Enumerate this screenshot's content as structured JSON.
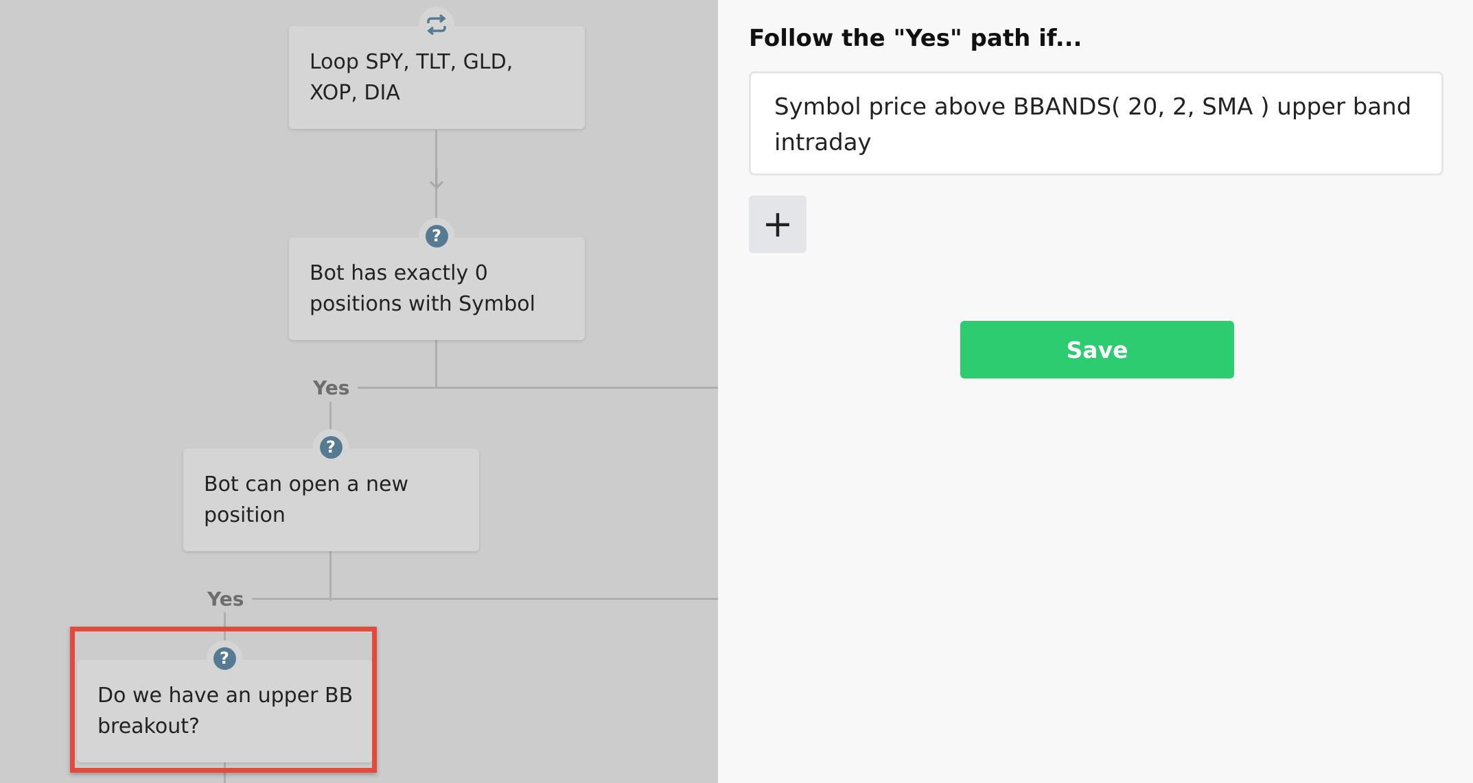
{
  "flow": {
    "nodes": [
      {
        "text": "Loop SPY, TLT, GLD, XOP, DIA",
        "icon": "loop-icon"
      },
      {
        "text": "Bot has exactly 0 positions with Symbol",
        "icon": "question-icon"
      },
      {
        "text": "Bot can open a new position",
        "icon": "question-icon"
      },
      {
        "text": "Do we have an upper BB breakout?",
        "icon": "question-icon"
      }
    ],
    "branches": [
      {
        "label": "Yes"
      },
      {
        "label": "Yes"
      }
    ],
    "icon_glyph": "?",
    "colors": {
      "icon": "#557a91",
      "highlight": "#e24a3b"
    }
  },
  "panel": {
    "title": "Follow the \"Yes\" path if...",
    "condition": "Symbol price above BBANDS( 20, 2, SMA ) upper band intraday",
    "add_label": "+",
    "save_label": "Save",
    "colors": {
      "save": "#2ecc71"
    }
  }
}
